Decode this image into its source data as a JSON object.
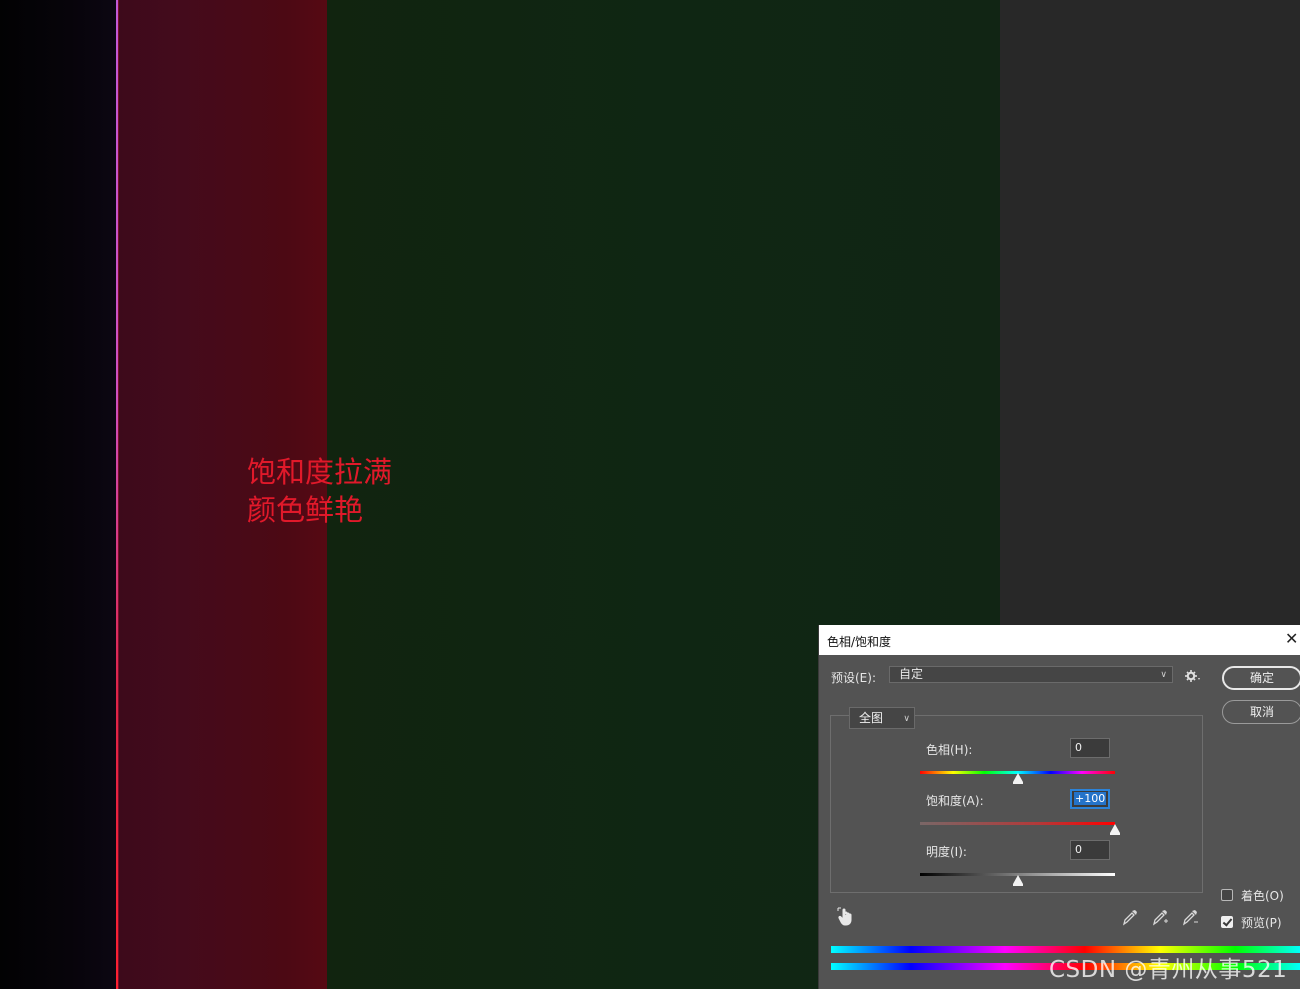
{
  "canvas": {
    "annotation_line1": "饱和度拉满",
    "annotation_line2": "颜色鲜艳",
    "annotation_color": "#e0192a"
  },
  "dialog": {
    "title": "色相/饱和度",
    "close_icon": "close-icon",
    "preset_label": "预设(E):",
    "preset_value": "自定",
    "gear_icon": "gear-icon",
    "ok_label": "确定",
    "cancel_label": "取消",
    "channel_value": "全图",
    "hue": {
      "label": "色相(H):",
      "value": "0",
      "level": 0,
      "min": -180,
      "max": 180
    },
    "saturation": {
      "label": "饱和度(A):",
      "value": "+100",
      "level": 100,
      "min": -100,
      "max": 100
    },
    "lightness": {
      "label": "明度(I):",
      "value": "0",
      "level": 0,
      "min": -100,
      "max": 100
    },
    "colorize": {
      "label": "着色(O)",
      "checked": false
    },
    "preview": {
      "label": "预览(P)",
      "checked": true
    },
    "icons": [
      "hand-target-icon",
      "eyedropper-icon",
      "eyedropper-plus-icon",
      "eyedropper-minus-icon"
    ]
  },
  "watermark": "CSDN @青州从事521"
}
